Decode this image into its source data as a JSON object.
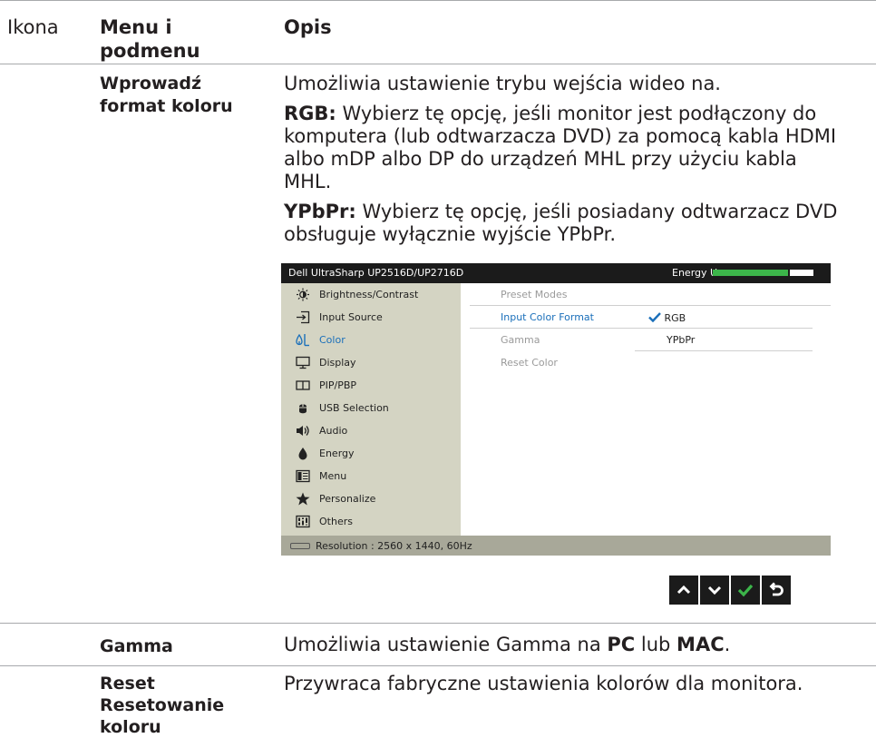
{
  "header": {
    "col_icon": "Ikona",
    "col_menu_line1": "Menu i",
    "col_menu_line2": "podmenu",
    "col_desc": "Opis"
  },
  "rows": {
    "input_color": {
      "title_line1": "Wprowadź",
      "title_line2": "format koloru",
      "desc_intro": "Umożliwia ustawienie trybu wejścia wideo na.",
      "rgb_label": "RGB:",
      "rgb_line1": " Wybierz tę opcję, jeśli monitor jest podłączony do",
      "rgb_line2": "komputera (lub odtwarzacza DVD) za pomocą kabla HDMI",
      "rgb_line3": "albo mDP albo DP do urządzeń MHL przy użyciu kabla",
      "rgb_line4": "MHL.",
      "ypbpr_label": "YPbPr:",
      "ypbpr_line1": " Wybierz tę opcję, jeśli posiadany odtwarzacz DVD",
      "ypbpr_line2": "obsługuje wyłącznie wyjście YPbPr."
    },
    "gamma": {
      "title": "Gamma",
      "desc_a": "Umożliwia ustawienie Gamma na ",
      "desc_pc": "PC",
      "desc_b": " lub ",
      "desc_mac": "MAC",
      "desc_c": "."
    },
    "reset": {
      "title_line1": "Reset",
      "title_line2": "Resetowanie",
      "title_line3": "koloru",
      "desc": "Przywraca fabryczne ustawienia kolorów dla monitora."
    }
  },
  "osd": {
    "title": "Dell UltraSharp UP2516D/UP2716D",
    "energy_label": "Energy Use",
    "energy_level_fraction": 0.75,
    "menu": [
      {
        "label": "Brightness/Contrast",
        "icon": "brightness-icon"
      },
      {
        "label": "Input Source",
        "icon": "input-source-icon"
      },
      {
        "label": "Color",
        "icon": "color-icon",
        "active": true
      },
      {
        "label": "Display",
        "icon": "display-icon"
      },
      {
        "label": "PIP/PBP",
        "icon": "pip-pbp-icon"
      },
      {
        "label": "USB Selection",
        "icon": "usb-icon"
      },
      {
        "label": "Audio",
        "icon": "audio-icon"
      },
      {
        "label": "Energy",
        "icon": "energy-icon"
      },
      {
        "label": "Menu",
        "icon": "menu-icon"
      },
      {
        "label": "Personalize",
        "icon": "star-icon"
      },
      {
        "label": "Others",
        "icon": "others-icon"
      }
    ],
    "options": [
      "Preset Modes",
      "Input Color Format",
      "Gamma",
      "Reset Color"
    ],
    "values": {
      "rgb": "RGB",
      "ypbpr": "YPbPr",
      "selected": "RGB"
    },
    "resolution": "Resolution : 2560 x 1440, 60Hz",
    "nav_buttons": [
      "up-icon",
      "down-icon",
      "check-icon",
      "back-icon"
    ],
    "colors": {
      "accent": "#1a6fba",
      "energy_green": "#3cb54a",
      "sidebar": "#d4d4c3",
      "statusbar": "#a8a899",
      "topbar": "#1b1b1b"
    }
  }
}
